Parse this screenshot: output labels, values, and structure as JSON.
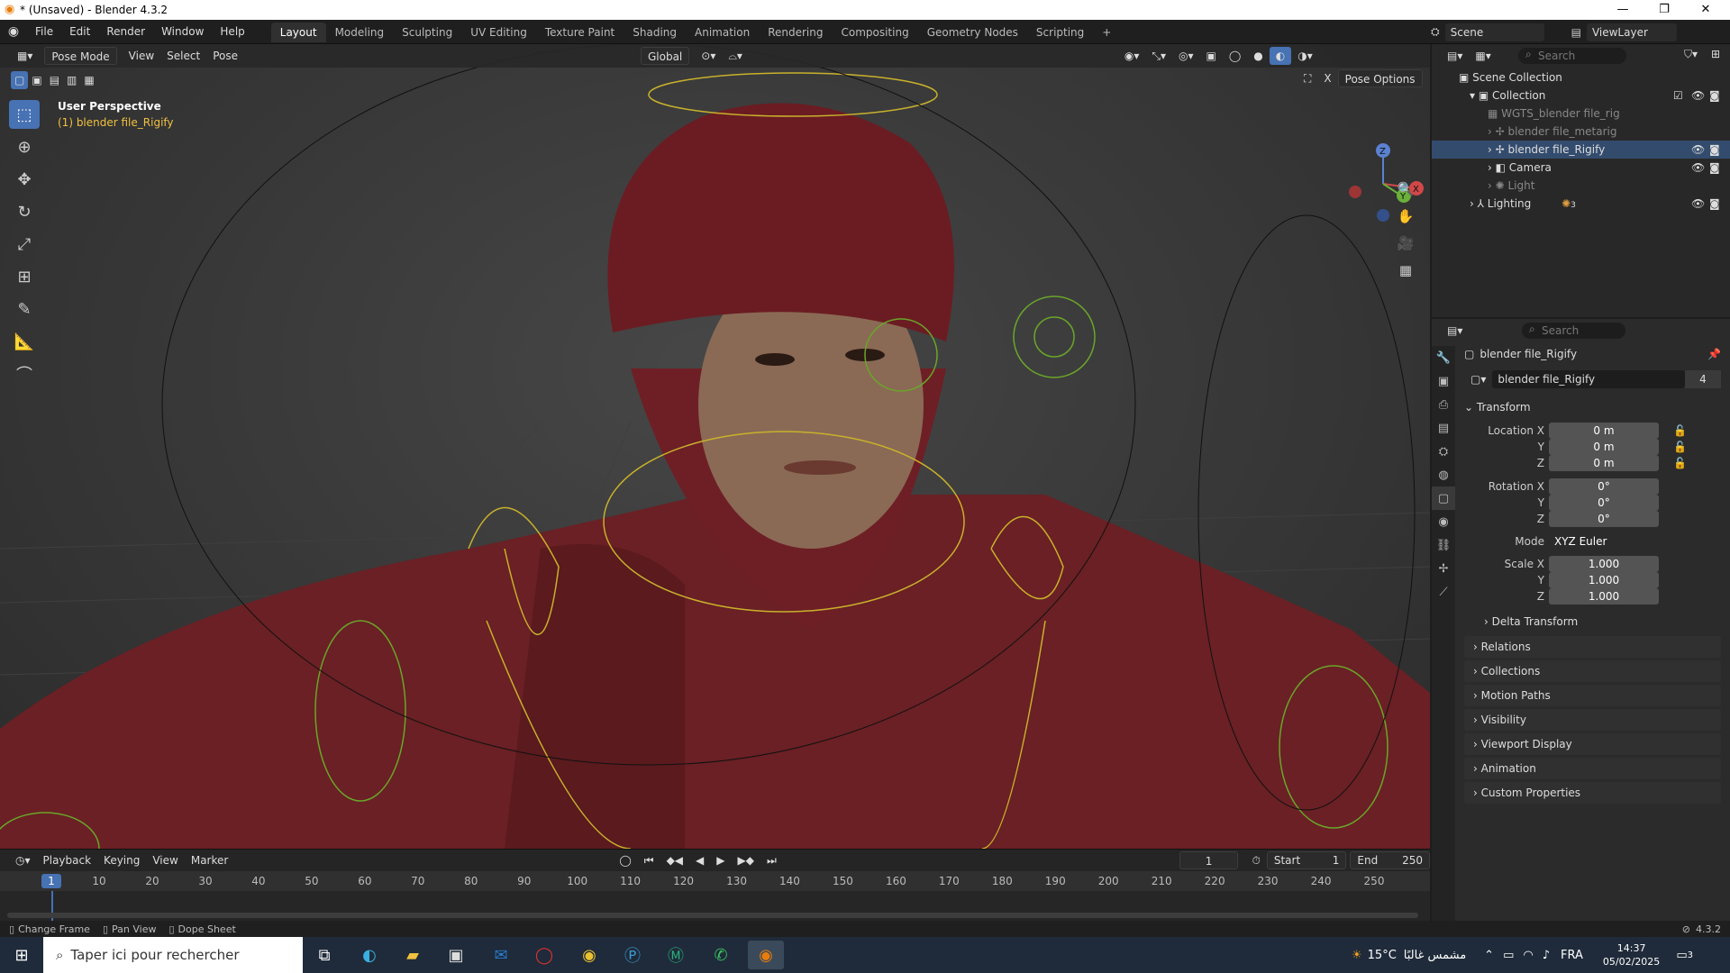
{
  "window": {
    "title": "* (Unsaved) - Blender 4.3.2",
    "minimize": "—",
    "restore": "❐",
    "close": "✕"
  },
  "menus": [
    "File",
    "Edit",
    "Render",
    "Window",
    "Help"
  ],
  "workspaces": [
    "Layout",
    "Modeling",
    "Sculpting",
    "UV Editing",
    "Texture Paint",
    "Shading",
    "Animation",
    "Rendering",
    "Compositing",
    "Geometry Nodes",
    "Scripting",
    "+"
  ],
  "scene": {
    "label": "Scene",
    "viewlayer": "ViewLayer"
  },
  "viewport": {
    "mode": "Pose Mode",
    "view": "View",
    "select": "Select",
    "pose": "Pose",
    "orientation": "Global",
    "pose_options": "Pose Options",
    "overlay_title": "User Perspective",
    "overlay_object": "(1) blender file_Rigify",
    "gizmo": {
      "x": "X",
      "y": "Y",
      "z": "Z"
    }
  },
  "tools": [
    "select-box",
    "cursor",
    "move",
    "rotate",
    "scale",
    "transform",
    "annotate",
    "measure",
    "relax"
  ],
  "outliner": {
    "search_placeholder": "Search",
    "rows": [
      {
        "label": "Scene Collection",
        "indent": 0
      },
      {
        "label": "Collection",
        "indent": 1
      },
      {
        "label": "WGTS_blender file_rig",
        "indent": 2
      },
      {
        "label": "blender file_metarig",
        "indent": 2
      },
      {
        "label": "blender file_Rigify",
        "indent": 2
      },
      {
        "label": "Camera",
        "indent": 2
      },
      {
        "label": "Light",
        "indent": 2
      },
      {
        "label": "Lighting",
        "indent": 1
      }
    ],
    "lighting_count": "3"
  },
  "properties": {
    "search_placeholder": "Search",
    "object_name": "blender file_Rigify",
    "data_name": "blender file_Rigify",
    "users": "4",
    "transform": {
      "title": "Transform",
      "location_label": "Location X",
      "y_label": "Y",
      "z_label": "Z",
      "location": [
        "0 m",
        "0 m",
        "0 m"
      ],
      "rotation_label": "Rotation X",
      "rotation": [
        "0°",
        "0°",
        "0°"
      ],
      "mode_label": "Mode",
      "mode": "XYZ Euler",
      "scale_label": "Scale X",
      "scale": [
        "1.000",
        "1.000",
        "1.000"
      ],
      "delta": "Delta Transform"
    },
    "panels": [
      "Relations",
      "Collections",
      "Motion Paths",
      "Visibility",
      "Viewport Display",
      "Animation",
      "Custom Properties"
    ]
  },
  "timeline": {
    "menus": [
      "Playback",
      "Keying",
      "View",
      "Marker"
    ],
    "current_frame": "1",
    "start_label": "Start",
    "start": "1",
    "end_label": "End",
    "end": "250",
    "ticks": [
      "10",
      "20",
      "30",
      "40",
      "50",
      "60",
      "70",
      "80",
      "90",
      "100",
      "110",
      "120",
      "130",
      "140",
      "150",
      "160",
      "170",
      "180",
      "190",
      "200",
      "210",
      "220",
      "230",
      "240",
      "250"
    ]
  },
  "status": {
    "change_frame": "Change Frame",
    "pan_view": "Pan View",
    "dope_sheet": "Dope Sheet",
    "version": "4.3.2"
  },
  "taskbar": {
    "search_placeholder": "Taper ici pour rechercher",
    "weather": "15°C",
    "weather_text": "مشمس غالبًا",
    "lang": "FRA",
    "time": "14:37",
    "date": "05/02/2025",
    "notif": "3"
  }
}
